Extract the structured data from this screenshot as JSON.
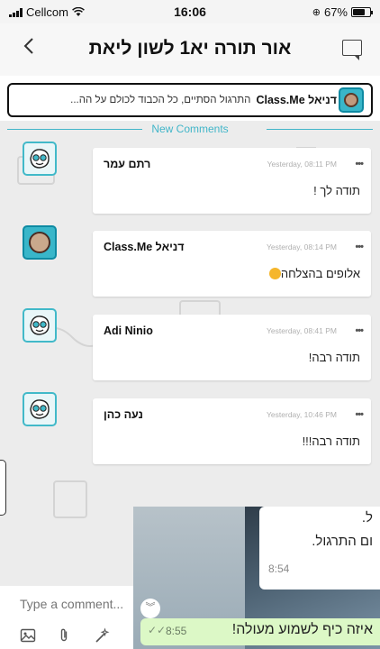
{
  "status_bar": {
    "carrier": "Cellcom",
    "time": "16:06",
    "battery": "67%"
  },
  "header": {
    "title": "אור תורה יא1 לשון ליאת",
    "back_icon": "chevron-left-icon",
    "action_icon": "chat-bubble-icon"
  },
  "pinned": {
    "author": "דניאל Class.Me",
    "text": "התרגול הסתיים, כל הכבוד לכולם על הה..."
  },
  "separator": {
    "label": "New Comments"
  },
  "comments": [
    {
      "author": "רתם עמר",
      "time": "Yesterday, 08:11 PM",
      "text": "תודה לך !",
      "avatar": "class-me-logo"
    },
    {
      "author": "דניאל Class.Me",
      "time": "Yesterday, 08:14 PM",
      "text": "אלופים בהצלחה",
      "emoji": "grinning-face",
      "avatar": "photo"
    },
    {
      "author": "Adi Ninio",
      "time": "Yesterday, 08:41 PM",
      "text": "תודה רבה!",
      "avatar": "class-me-logo"
    },
    {
      "author": "נעה כהן",
      "time": "Yesterday, 10:46 PM",
      "text": "תודה רבה!!!",
      "avatar": "class-me-logo"
    }
  ],
  "more_label": "•••",
  "whatsapp": {
    "line1": "ל.",
    "line2": "ום התרגול.",
    "time1": "8:54",
    "message": "איזה כיף לשמוע מעולה!",
    "time2": "8:55",
    "ticks": "✓✓",
    "scroll_glyph": "︾"
  },
  "composer": {
    "placeholder": "Type a comment..."
  },
  "colors": {
    "accent": "#42b6c9",
    "background": "#ececec",
    "whatsapp_out": "#dcf8c6"
  }
}
